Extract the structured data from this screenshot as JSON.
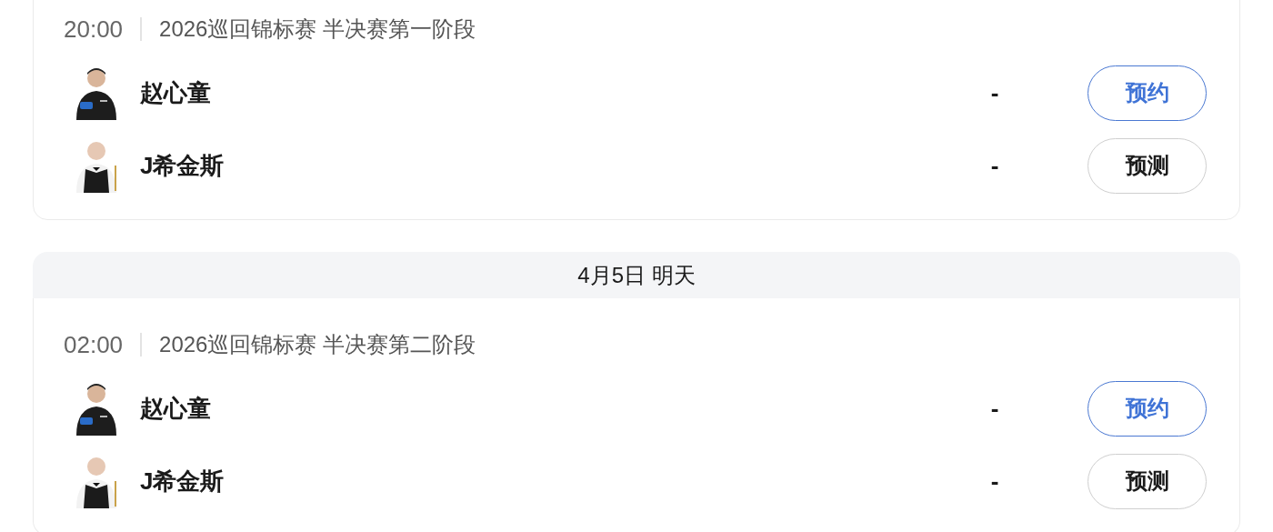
{
  "days": [
    {
      "matches": [
        {
          "time": "20:00",
          "event": "2026巡回锦标赛 半决赛第一阶段",
          "players": [
            {
              "name": "赵心童",
              "score": "-",
              "button": {
                "label": "预约",
                "kind": "reserve"
              }
            },
            {
              "name": "J希金斯",
              "score": "-",
              "button": {
                "label": "预测",
                "kind": "predict"
              }
            }
          ]
        }
      ]
    },
    {
      "date": "4月5日 明天",
      "matches": [
        {
          "time": "02:00",
          "event": "2026巡回锦标赛 半决赛第二阶段",
          "players": [
            {
              "name": "赵心童",
              "score": "-",
              "button": {
                "label": "预约",
                "kind": "reserve"
              }
            },
            {
              "name": "J希金斯",
              "score": "-",
              "button": {
                "label": "预测",
                "kind": "predict"
              }
            }
          ]
        }
      ]
    }
  ]
}
